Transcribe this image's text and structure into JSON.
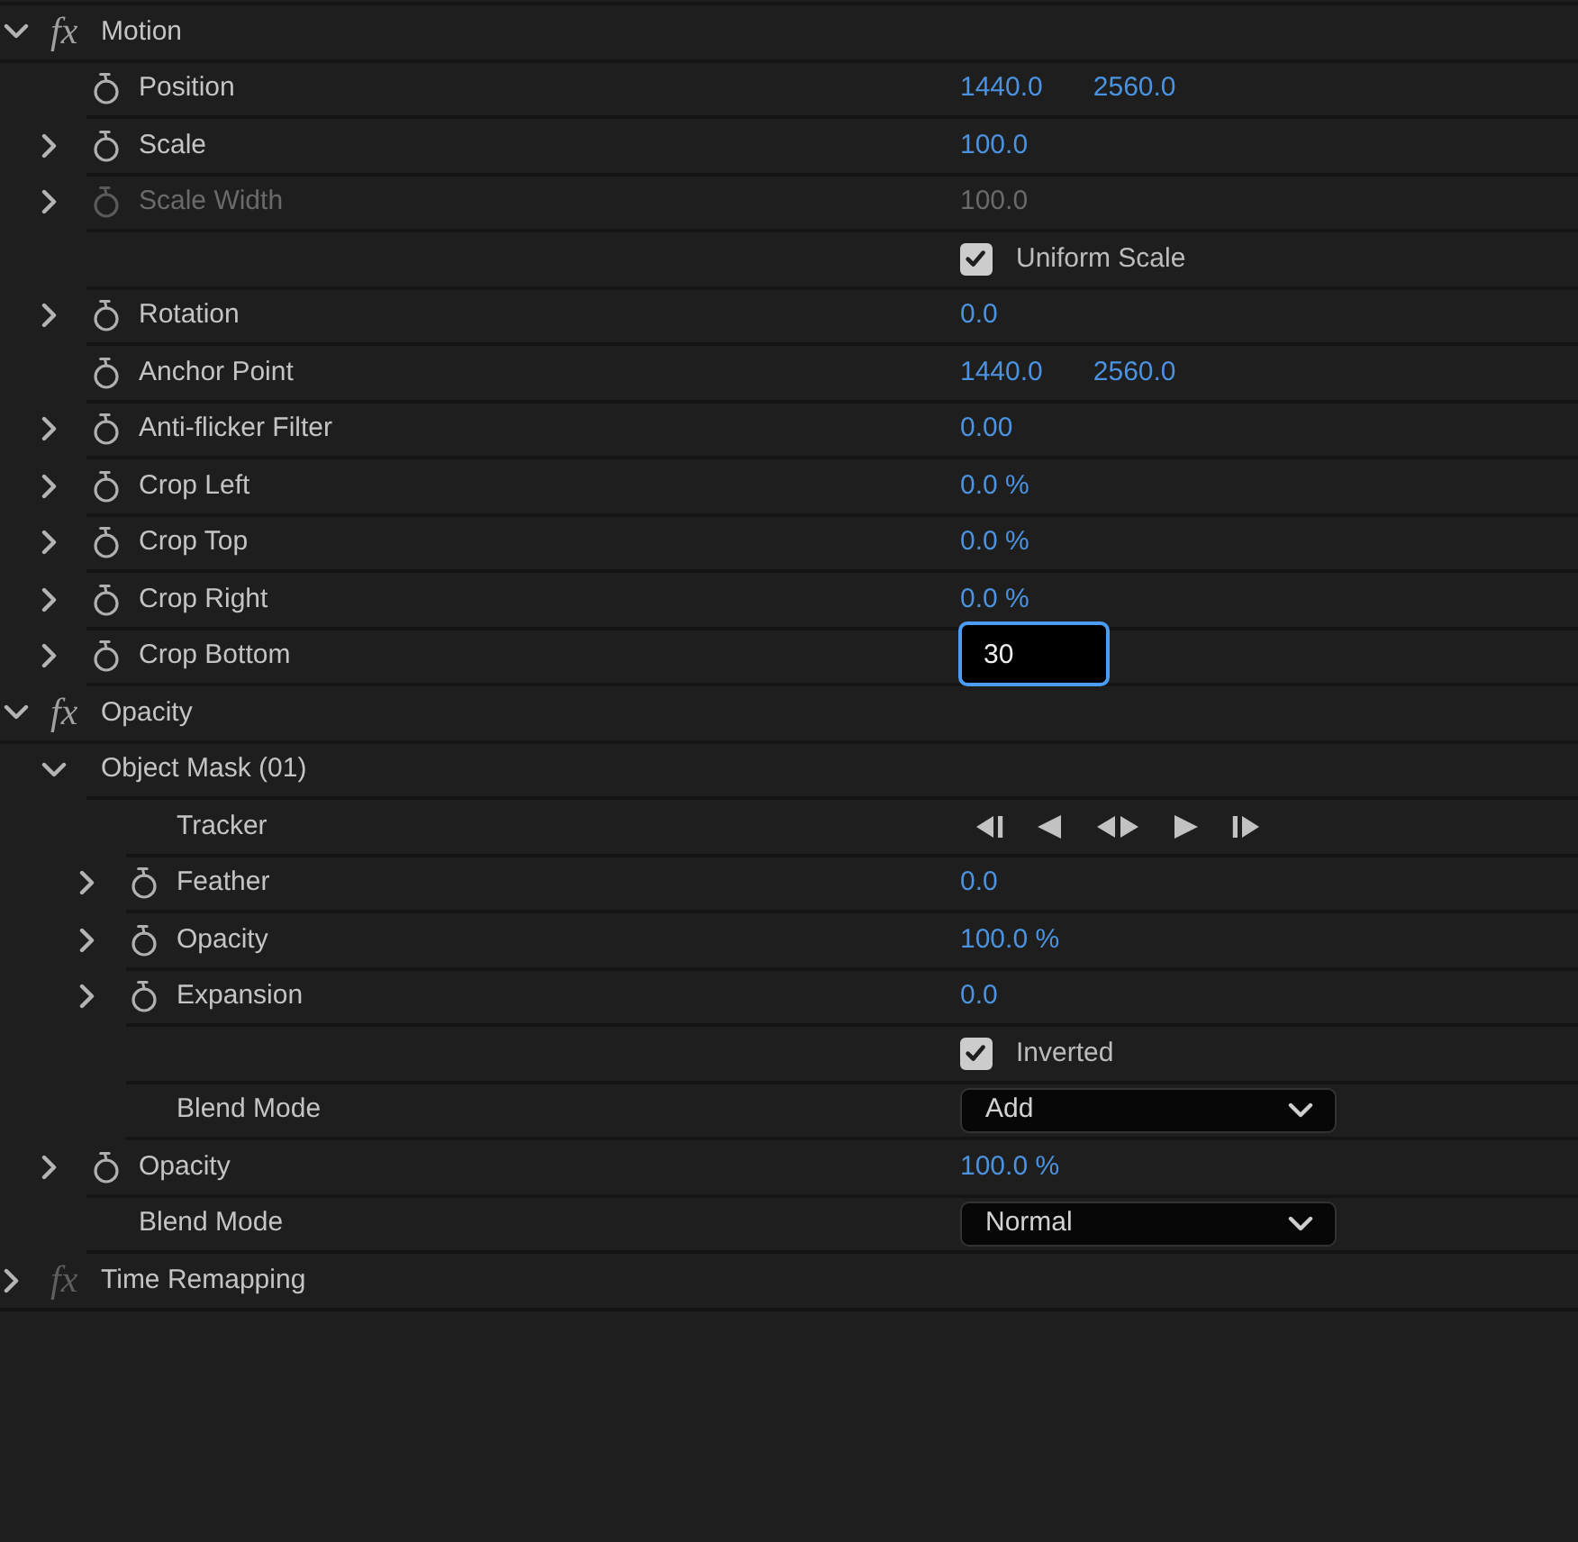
{
  "panel": {
    "effects": [
      {
        "kind": "effect",
        "label": "Motion",
        "icon_text": "fx",
        "fx_active": true,
        "expanded": true,
        "children": [
          {
            "kind": "value",
            "label": "Position",
            "values": [
              "1440.0",
              "2560.0"
            ]
          },
          {
            "kind": "value",
            "label": "Scale",
            "expanded": false,
            "values": [
              "100.0"
            ]
          },
          {
            "kind": "value",
            "label": "Scale Width",
            "expanded": false,
            "disabled": true,
            "values": [
              "100.0"
            ]
          },
          {
            "kind": "checkbox",
            "label": "Uniform Scale",
            "checked": true
          },
          {
            "kind": "value",
            "label": "Rotation",
            "expanded": false,
            "values": [
              "0.0"
            ]
          },
          {
            "kind": "value",
            "label": "Anchor Point",
            "values": [
              "1440.0",
              "2560.0"
            ]
          },
          {
            "kind": "value",
            "label": "Anti-flicker Filter",
            "expanded": false,
            "values": [
              "0.00"
            ]
          },
          {
            "kind": "value",
            "label": "Crop Left",
            "expanded": false,
            "values": [
              "0.0 %"
            ]
          },
          {
            "kind": "value",
            "label": "Crop Top",
            "expanded": false,
            "values": [
              "0.0 %"
            ]
          },
          {
            "kind": "value",
            "label": "Crop Right",
            "expanded": false,
            "values": [
              "0.0 %"
            ]
          },
          {
            "kind": "input",
            "label": "Crop Bottom",
            "expanded": false,
            "value": "30",
            "focused": true
          }
        ]
      },
      {
        "kind": "effect",
        "label": "Opacity",
        "icon_text": "fx",
        "fx_active": true,
        "expanded": true,
        "children": [
          {
            "kind": "group",
            "label": "Object Mask (01)",
            "expanded": true,
            "children": [
              {
                "kind": "tracker",
                "label": "Tracker"
              },
              {
                "kind": "value",
                "label": "Feather",
                "expanded": false,
                "values": [
                  "0.0"
                ]
              },
              {
                "kind": "value",
                "label": "Opacity",
                "expanded": false,
                "values": [
                  "100.0 %"
                ]
              },
              {
                "kind": "value",
                "label": "Expansion",
                "expanded": false,
                "values": [
                  "0.0"
                ]
              },
              {
                "kind": "checkbox",
                "label": "Inverted",
                "checked": true
              },
              {
                "kind": "dropdown",
                "label": "Blend Mode",
                "value": "Add"
              }
            ]
          },
          {
            "kind": "value",
            "label": "Opacity",
            "expanded": false,
            "values": [
              "100.0 %"
            ]
          },
          {
            "kind": "dropdown",
            "label": "Blend Mode",
            "value": "Normal"
          }
        ]
      },
      {
        "kind": "effect",
        "label": "Time Remapping",
        "icon_text": "fx",
        "fx_active": false,
        "expanded": false
      }
    ]
  }
}
